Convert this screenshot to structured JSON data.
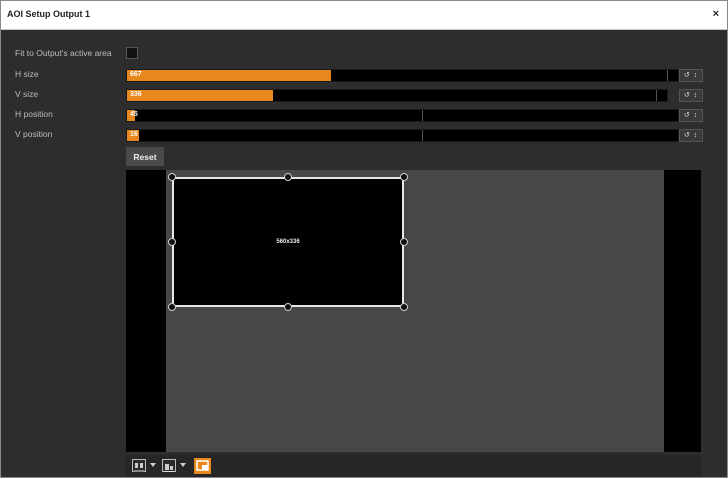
{
  "window": {
    "title": "AOI Setup Output 1",
    "close_glyph": "×"
  },
  "settings": {
    "fit_label": "Fit to Output's active area",
    "fit_checked": false,
    "rows": [
      {
        "id": "hsize",
        "label": "H size",
        "value": "667",
        "fill_fraction": 0.37,
        "tick_fraction": 0.98
      },
      {
        "id": "vsize",
        "label": "V size",
        "value": "336",
        "fill_fraction": 0.27,
        "tick_fraction": 0.98
      },
      {
        "id": "hpos",
        "label": "H position",
        "value": "45",
        "fill_fraction": 0.014,
        "tick_fraction": 0.535
      },
      {
        "id": "vpos",
        "label": "V position",
        "value": "16",
        "fill_fraction": 0.022,
        "tick_fraction": 0.535
      }
    ],
    "control_glyphs": "↺ ↕"
  },
  "reset_label": "Reset",
  "preview": {
    "aoi_label": "560x336"
  },
  "toolbar": {
    "icons": [
      "align-grid-icon",
      "align-bottom-icon",
      "aoi-tool-icon"
    ],
    "accent": "#e8871e"
  }
}
